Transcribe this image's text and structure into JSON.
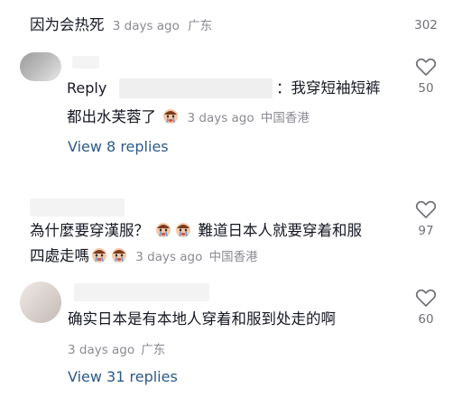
{
  "top_comment": {
    "text": "因为会热死",
    "time": "3 days ago",
    "location": "广东",
    "likes": "302"
  },
  "reply1": {
    "prefix": "Reply",
    "text_line1": "：我穿短袖短裤",
    "text_line2": "都出水芙蓉了",
    "emoji": "crying-face",
    "time": "3 days ago",
    "location": "中国香港",
    "likes": "50"
  },
  "view_replies_1": "View 8 replies",
  "comment2": {
    "line1_a": "為什麼要穿漢服？",
    "line1_b": "難道日本人就要穿着和服",
    "line2": "四處走嗎",
    "emoji": "crying-face",
    "time": "3 days ago",
    "location": "中国香港",
    "likes": "97"
  },
  "reply2": {
    "text": "确实日本是有本地人穿着和服到处走的啊",
    "time": "3 days ago",
    "location": "广东",
    "likes": "60"
  },
  "view_replies_2": "View 31 replies",
  "icons": {
    "heart": "heart-outline-icon"
  },
  "colors": {
    "text": "#161823",
    "meta": "#8a8b91",
    "link": "#2b5a8a"
  }
}
